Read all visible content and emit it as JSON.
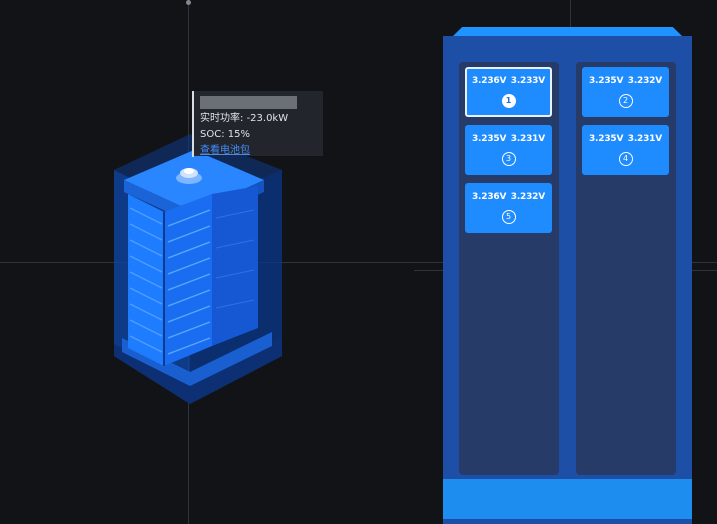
{
  "tooltip": {
    "name_masked": "",
    "power_label": "实时功率: ",
    "power_value": "-23.0kW",
    "soc_label": "SOC: ",
    "soc_value": "15%",
    "link_label": "查看电池包"
  },
  "cabinet": {
    "left_packs": [
      {
        "v1": "3.236V",
        "v2": "3.233V",
        "num": "1",
        "active": true
      },
      {
        "v1": "3.235V",
        "v2": "3.231V",
        "num": "3",
        "active": false
      },
      {
        "v1": "3.236V",
        "v2": "3.232V",
        "num": "5",
        "active": false
      }
    ],
    "right_packs": [
      {
        "v1": "3.235V",
        "v2": "3.232V",
        "num": "2",
        "active": false
      },
      {
        "v1": "3.235V",
        "v2": "3.231V",
        "num": "4",
        "active": false
      }
    ]
  },
  "colors": {
    "background": "#121316",
    "accent": "#1e8bff",
    "cabinet_body": "#1e4fa6",
    "column": "#273b68",
    "link": "#3f8dff"
  }
}
